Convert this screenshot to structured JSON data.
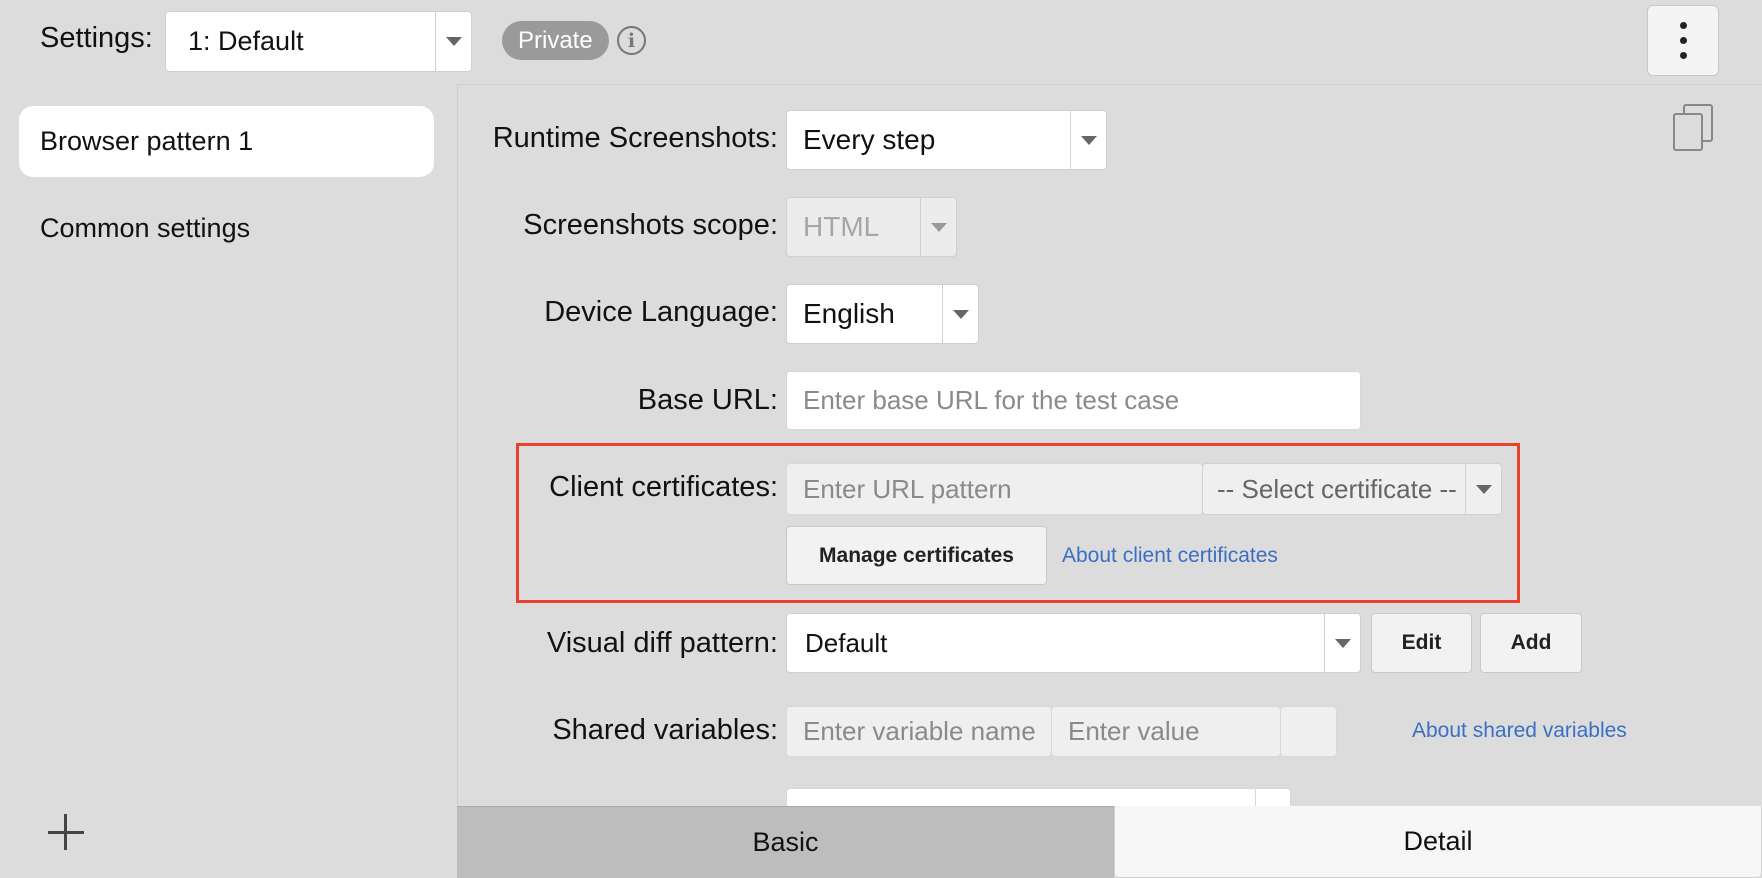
{
  "header": {
    "settings_label": "Settings:",
    "settings_value": "1: Default",
    "private_badge": "Private",
    "info_glyph": "i"
  },
  "sidebar": {
    "items": [
      {
        "label": "Browser pattern 1",
        "active": true
      },
      {
        "label": "Common settings",
        "active": false
      }
    ]
  },
  "form": {
    "runtime_screenshots": {
      "label": "Runtime Screenshots:",
      "value": "Every step"
    },
    "screenshots_scope": {
      "label": "Screenshots scope:",
      "value": "HTML"
    },
    "device_language": {
      "label": "Device Language:",
      "value": "English"
    },
    "base_url": {
      "label": "Base URL:",
      "placeholder": "Enter base URL for the test case"
    },
    "client_certificates": {
      "label": "Client certificates:",
      "url_placeholder": "Enter URL pattern",
      "select_value": "-- Select certificate --",
      "manage_button": "Manage certificates",
      "about_link": "About client certificates"
    },
    "visual_diff": {
      "label": "Visual diff pattern:",
      "value": "Default",
      "edit_button": "Edit",
      "add_button": "Add"
    },
    "shared_variables": {
      "label": "Shared variables:",
      "name_placeholder": "Enter variable name",
      "value_placeholder": "Enter value",
      "about_link": "About shared variables"
    }
  },
  "tabs": [
    {
      "label": "Basic",
      "active": true
    },
    {
      "label": "Detail",
      "active": false
    }
  ],
  "colors": {
    "highlight": "#e8402a",
    "link": "#3a6fc4"
  }
}
